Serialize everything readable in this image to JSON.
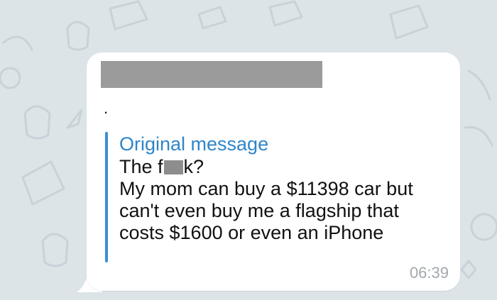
{
  "chat": {
    "message": {
      "sender_text": "",
      "body_dot": ".",
      "quote": {
        "title": "Original message",
        "line1_prefix": "The f",
        "line1_suffix": "k?",
        "line2": "My mom can buy a $11398 car but",
        "line3": "can't even buy me a flagship that",
        "line4": "costs $1600 or even an iPhone"
      },
      "time": "06:39"
    }
  },
  "colors": {
    "background": "#dce4e8",
    "bubble": "#ffffff",
    "accent": "#2f85c9",
    "quote_bar": "#3a8fd4",
    "redaction": "#9b9b9b",
    "timestamp": "#a3a8ab"
  }
}
